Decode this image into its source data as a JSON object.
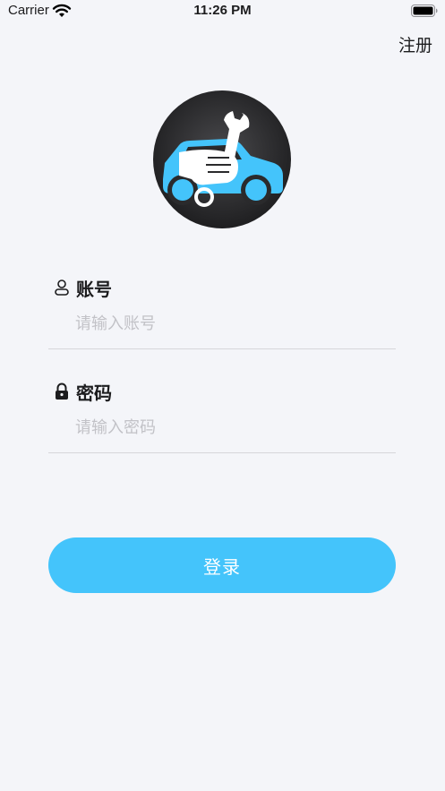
{
  "status_bar": {
    "carrier": "Carrier",
    "time": "11:26 PM"
  },
  "header": {
    "register_label": "注册"
  },
  "logo": {
    "icon": "car-repair-logo-icon",
    "colors": {
      "circle": "#2a2a2c",
      "car": "#44c4fb",
      "wrench": "#ffffff"
    }
  },
  "form": {
    "account": {
      "label": "账号",
      "placeholder": "请输入账号",
      "value": "",
      "icon": "user-icon"
    },
    "password": {
      "label": "密码",
      "placeholder": "请输入密码",
      "value": "",
      "icon": "lock-icon"
    }
  },
  "actions": {
    "login_label": "登录"
  },
  "theme": {
    "accent": "#44c4fb",
    "background": "#f4f5f9"
  }
}
